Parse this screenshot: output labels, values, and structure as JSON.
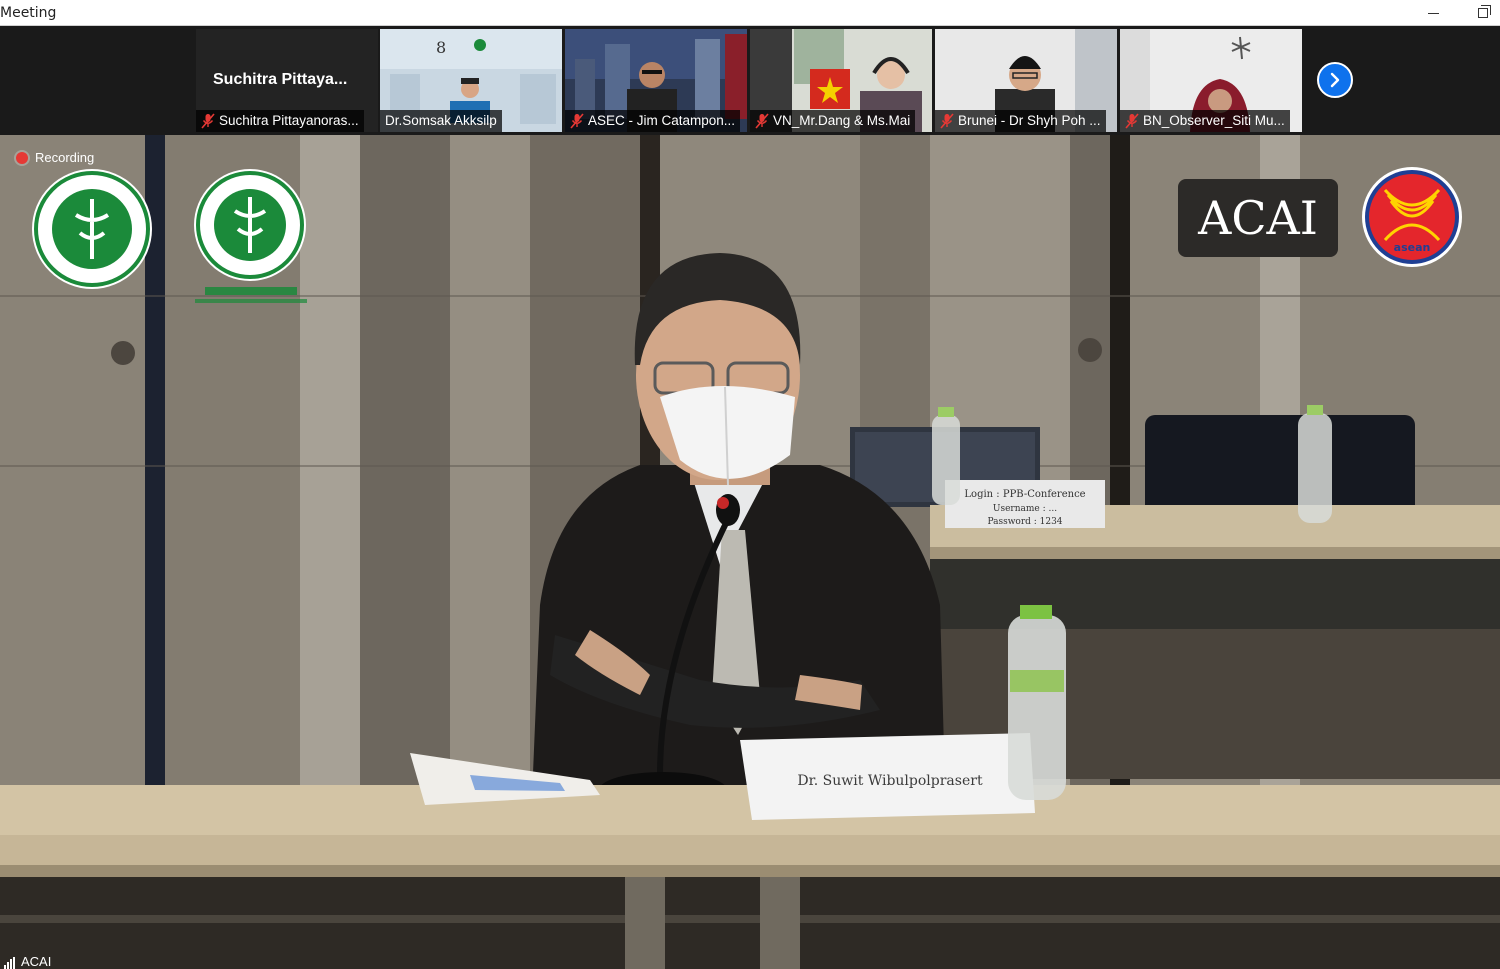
{
  "window": {
    "title": "Meeting"
  },
  "strip": {
    "tiles": [
      {
        "big_name": "Suchitra  Pittaya...",
        "label": "Suchitra Pittayanoras...",
        "muted": true
      },
      {
        "label": "Dr.Somsak Akksilp",
        "muted": false
      },
      {
        "label": "ASEC - Jim Catampon...",
        "muted": true
      },
      {
        "label": "VN_Mr.Dang & Ms.Mai",
        "muted": true
      },
      {
        "label": "Brunei - Dr Shyh Poh ...",
        "muted": true
      },
      {
        "label": "BN_Observer_Siti Mu...",
        "muted": true
      }
    ],
    "next_icon": "chevron-right-icon"
  },
  "main_video": {
    "recording_label": "Recording",
    "speaker_name": "ACAI",
    "logos": {
      "acai_text": "ACAI",
      "asean_text": "asean"
    },
    "nameplate": "Dr. Suwit Wibulpolprasert",
    "sign_lines": [
      "Login : PPB-Conference",
      "Username : ...",
      "Password : 1234"
    ]
  },
  "colors": {
    "accent": "#0e72ed",
    "recording": "#e53935",
    "moph_green": "#1b8a3a"
  }
}
